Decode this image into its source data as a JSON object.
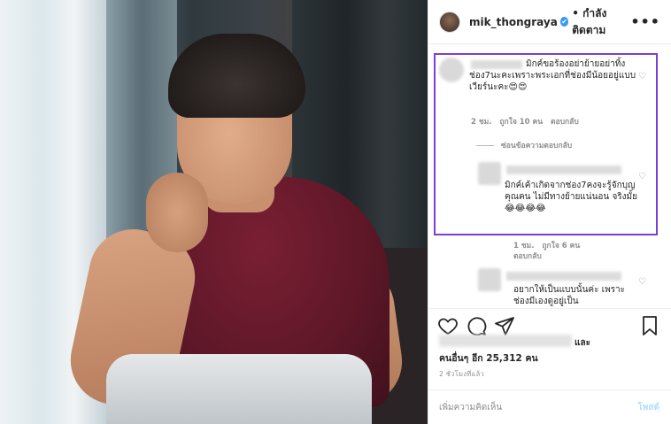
{
  "header": {
    "username": "mik_thongraya",
    "verified_mark": "✔",
    "separator": "•",
    "follow_label": "กำลังติดตาม",
    "more_label": "•••"
  },
  "comments": [
    {
      "text": "มิกค์ขอร้องอย่าย้ายอย่าทิ้งช่อง7นะคะเพราะพระเอกที่ช่องมีน้อยอยู่แบบเวียร์นะคะ😍😍",
      "time": "2 ชม.",
      "likes": "ถูกใจ 10 คน",
      "reply": "ตอบกลับ"
    },
    {
      "text": "มิกค์เค้าเกิดจากช่อง7คงจะรู้จักบุญคุณคน ไม่มีทางย้ายแน่นอน จริงมั้ย😂😂😂😂",
      "time": "1 ชม.",
      "likes": "ถูกใจ 6 คน",
      "reply": "ตอบกลับ"
    },
    {
      "text": "อยากให้เป็นแบบนั้นค่ะ เพราะช่องมีเองดูอยู่เป็น"
    }
  ],
  "hide_replies": "ซ่อนข้อความตอบกลับ",
  "likes_suffix": "และ",
  "likes_count": "คนอื่นๆ อีก 25,312 คน",
  "time_ago": "2 ชั่วโมงที่แล้ว",
  "add_comment_placeholder": "เพิ่มความคิดเห็น",
  "post_label": "โพสต์",
  "heart_glyph": "♡",
  "colors": {
    "highlight": "#7e3cd6",
    "post_disabled": "#b2dffc",
    "verified": "#3897f0"
  }
}
